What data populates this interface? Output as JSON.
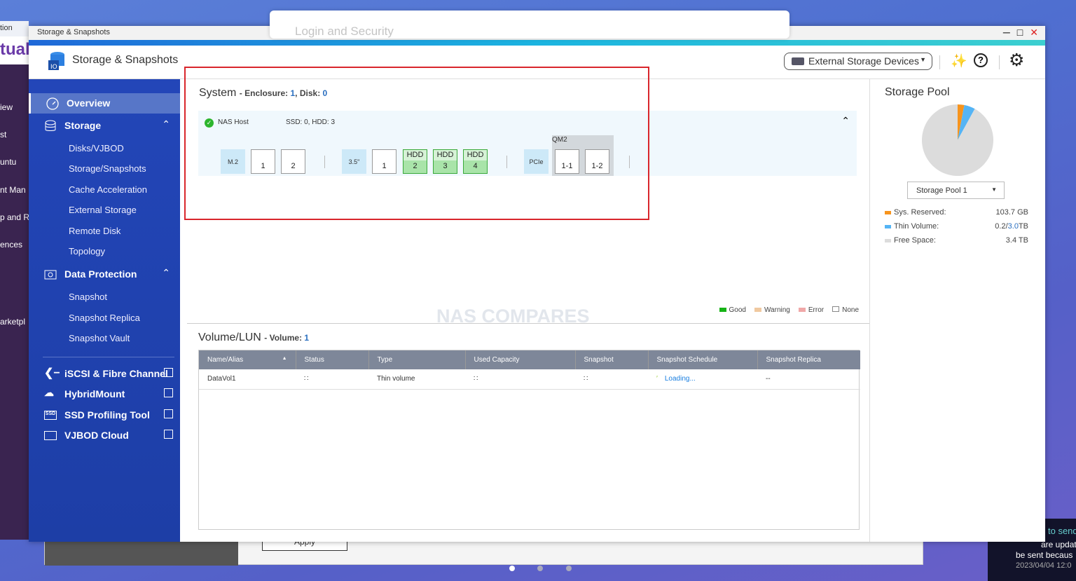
{
  "background_window": {
    "title_partial": "tion",
    "brand_partial": "tual",
    "items": [
      "iew",
      "st",
      "untu",
      "nt Man",
      "p and R",
      "ences",
      "arketpl"
    ]
  },
  "login_dialog": {
    "title": "Login and Security"
  },
  "behind_dialog": {
    "apply_label": "Apply"
  },
  "notification": {
    "line1": "to send",
    "line2": "are updat",
    "line3": "be sent becaus",
    "line4": "2023/04/04 12:0"
  },
  "window": {
    "titlebar": "Storage & Snapshots",
    "app_title": "Storage & Snapshots"
  },
  "header": {
    "external_devices_label": "External Storage Devices"
  },
  "sidebar": {
    "overview": "Overview",
    "storage": "Storage",
    "storage_items": [
      "Disks/VJBOD",
      "Storage/Snapshots",
      "Cache Acceleration",
      "External Storage",
      "Remote Disk",
      "Topology"
    ],
    "data_protection": "Data Protection",
    "dp_items": [
      "Snapshot",
      "Snapshot Replica",
      "Snapshot Vault"
    ],
    "links": [
      "iSCSI & Fibre Channel",
      "HybridMount",
      "SSD Profiling Tool",
      "VJBOD Cloud"
    ]
  },
  "system": {
    "title": "System",
    "enclosure_label": "- Enclosure: ",
    "enclosure_value": "1",
    "disk_label": ", Disk: ",
    "disk_value": "0",
    "host_name": "NAS Host",
    "host_summary": "SSD: 0, HDD: 3",
    "m2_label": "M.2",
    "m2_slots": [
      "1",
      "2"
    ],
    "bay_label": "3.5\"",
    "bay_slots": [
      {
        "n": "1",
        "type": ""
      },
      {
        "n": "2",
        "type": "HDD"
      },
      {
        "n": "3",
        "type": "HDD"
      },
      {
        "n": "4",
        "type": "HDD"
      }
    ],
    "pcie_label": "PCIe",
    "qm2_label": "QM2",
    "qm2_slots": [
      "1-1",
      "1-2"
    ]
  },
  "watermark": "NAS COMPARES",
  "legend": {
    "good": "Good",
    "warning": "Warning",
    "error": "Error",
    "none": "None",
    "colors": {
      "good": "#16b316",
      "warning": "#f0c9a0",
      "error": "#f0a8a8",
      "none": "#ffffff"
    }
  },
  "volume": {
    "title": "Volume/LUN",
    "count_label": "- Volume: ",
    "count_value": "1",
    "columns": [
      "Name/Alias",
      "Status",
      "Type",
      "Used Capacity",
      "Snapshot",
      "Snapshot Schedule",
      "Snapshot Replica"
    ],
    "rows": [
      {
        "name": "DataVol1",
        "type": "Thin volume",
        "schedule": "Loading...",
        "replica": "--"
      }
    ]
  },
  "storage_pool": {
    "title": "Storage Pool",
    "selected": "Storage Pool 1",
    "sys_reserved_label": "Sys. Reserved:",
    "sys_reserved_value": "103.7 GB",
    "thin_label": "Thin Volume:",
    "thin_used": "0.2/",
    "thin_total": "3.0",
    "thin_unit": "TB",
    "free_label": "Free Space:",
    "free_value": "3.4 TB",
    "pie_fractions": {
      "sys_reserved": 0.03,
      "thin_volume": 0.05,
      "free": 0.92
    },
    "colors": {
      "sys_reserved": "#f7941d",
      "thin_volume": "#55b4f5",
      "free": "#dcdcdc"
    }
  }
}
